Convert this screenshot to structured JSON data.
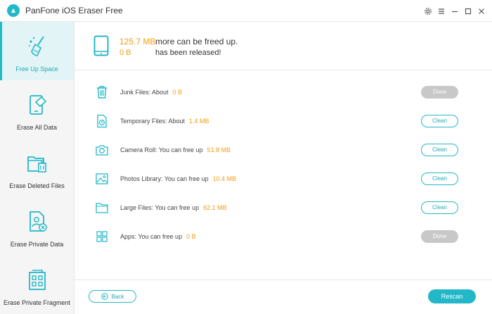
{
  "app": {
    "title": "PanFone iOS Eraser Free",
    "accent_color": "#23b8c8",
    "value_color": "#f39c12"
  },
  "window_controls": [
    {
      "name": "settings-icon"
    },
    {
      "name": "menu-icon"
    },
    {
      "name": "minimize-icon"
    },
    {
      "name": "maximize-icon"
    },
    {
      "name": "close-icon"
    }
  ],
  "sidebar": {
    "items": [
      {
        "label": "Free Up Space",
        "icon": "broom-sparkle-icon",
        "active": true
      },
      {
        "label": "Erase All Data",
        "icon": "phone-eraser-icon",
        "active": false
      },
      {
        "label": "Erase Deleted Files",
        "icon": "folder-trash-icon",
        "active": false
      },
      {
        "label": "Erase Private Data",
        "icon": "user-file-x-icon",
        "active": false
      },
      {
        "label": "Erase Private Fragment",
        "icon": "grid-file-icon",
        "active": false
      }
    ]
  },
  "header": {
    "icon": "tablet-icon",
    "freeable_value": "125.7 MB",
    "freeable_text": "more can be freed up.",
    "released_value": "0 B",
    "released_text": "has been released!"
  },
  "rows": [
    {
      "icon": "trash-icon",
      "label": "Junk Files: About",
      "value": "0 B",
      "button": "Done",
      "state": "done"
    },
    {
      "icon": "clock-file-icon",
      "label": "Temporary Files: About",
      "value": "1.4 MB",
      "button": "Clean",
      "state": "clean"
    },
    {
      "icon": "camera-icon",
      "label": "Camera Roll: You can free up",
      "value": "51.8 MB",
      "button": "Clean",
      "state": "clean"
    },
    {
      "icon": "image-icon",
      "label": "Photos Library: You can free up",
      "value": "10.4 MB",
      "button": "Clean",
      "state": "clean"
    },
    {
      "icon": "folder-icon",
      "label": "Large Files: You can free up",
      "value": "62.1 MB",
      "button": "Clean",
      "state": "clean"
    },
    {
      "icon": "apps-grid-icon",
      "label": "Apps: You can free up",
      "value": "0 B",
      "button": "Done",
      "state": "done"
    }
  ],
  "footer": {
    "back_label": "Back",
    "rescan_label": "Rescan"
  }
}
